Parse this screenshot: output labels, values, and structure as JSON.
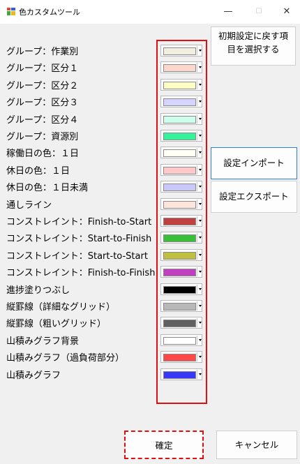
{
  "window": {
    "title": "色カスタムツール",
    "minimize": "—",
    "maximize": "☐",
    "close": "✕"
  },
  "rows": [
    {
      "label": "グループ：作業別",
      "color": "#f1f0e0"
    },
    {
      "label": "グループ：区分１",
      "color": "#fbd7cc"
    },
    {
      "label": "グループ：区分２",
      "color": "#feffc4"
    },
    {
      "label": "グループ：区分３",
      "color": "#d4d4ff"
    },
    {
      "label": "グループ：区分４",
      "color": "#cdfdeb"
    },
    {
      "label": "グループ：資源別",
      "color": "#35f39a"
    },
    {
      "label": "稼働日の色：１日",
      "color": "#fffff4"
    },
    {
      "label": "休日の色：１日",
      "color": "#ffc9c9"
    },
    {
      "label": "休日の色：１日未満",
      "color": "#c8c9f8"
    },
    {
      "label": "通しライン",
      "color": "#fde5db"
    },
    {
      "label": "コンストレイント：Finish-to-Start",
      "color": "#c04040"
    },
    {
      "label": "コンストレイント：Start-to-Finish",
      "color": "#38c038"
    },
    {
      "label": "コンストレイント：Start-to-Start",
      "color": "#c0c040"
    },
    {
      "label": "コンストレイント：Finish-to-Finish",
      "color": "#c040c0"
    },
    {
      "label": "進捗塗りつぶし",
      "color": "#000000"
    },
    {
      "label": "縦罫線（詳細なグリッド）",
      "color": "#b8b8b8"
    },
    {
      "label": "縦罫線（粗いグリッド）",
      "color": "#606060"
    },
    {
      "label": "山積みグラフ背景",
      "color": "#ffffff"
    },
    {
      "label": "山積みグラフ（過負荷部分）",
      "color": "#ff4848"
    },
    {
      "label": "山積みグラフ",
      "color": "#3838f8"
    }
  ],
  "buttons": {
    "reset_line1": "初期設定に戻す項",
    "reset_line2": "目を選択する",
    "import": "設定インポート",
    "export": "設定エクスポート",
    "ok": "確定",
    "cancel": "キャンセル"
  }
}
